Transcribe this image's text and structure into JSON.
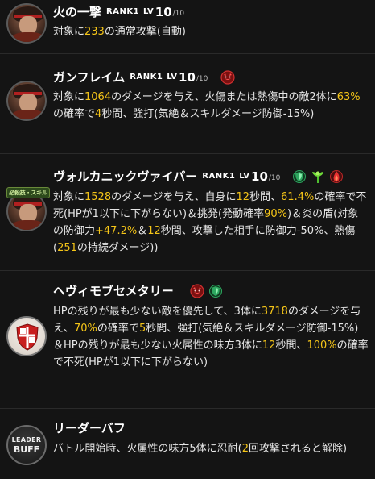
{
  "skills": [
    {
      "title": "火の一撃",
      "rank": "RANK1",
      "lv_prefix": "LV",
      "lv": "10",
      "lv_max": "/10",
      "desc": [
        {
          "t": "対象に"
        },
        {
          "t": "233",
          "h": true
        },
        {
          "t": "の通常攻撃(自動)"
        }
      ]
    },
    {
      "title": "ガンフレイム",
      "rank": "RANK1",
      "lv_prefix": "LV",
      "lv": "10",
      "lv_max": "/10",
      "desc": [
        {
          "t": "対象に"
        },
        {
          "t": "1064",
          "h": true
        },
        {
          "t": "のダメージを与え、火傷または熱傷中の敵2体に"
        },
        {
          "t": "63%",
          "h": true
        },
        {
          "t": "の確率で"
        },
        {
          "t": "4",
          "h": true
        },
        {
          "t": "秒間、強打(気絶＆スキルダメージ防御-15%)"
        }
      ]
    },
    {
      "title": "ヴォルカニックヴァイパー",
      "rank": "RANK1",
      "lv_prefix": "LV",
      "lv": "10",
      "lv_max": "/10",
      "badge": "必殺技・スキル",
      "desc": [
        {
          "t": "対象に"
        },
        {
          "t": "1528",
          "h": true
        },
        {
          "t": "のダメージを与え、自身に"
        },
        {
          "t": "12",
          "h": true
        },
        {
          "t": "秒間、"
        },
        {
          "t": "61.4%",
          "h": true
        },
        {
          "t": "の確率で不死(HPが1以下に下がらない)＆挑発(発動確率"
        },
        {
          "t": "90%",
          "h": true
        },
        {
          "t": ")＆炎の盾(対象の防御力"
        },
        {
          "t": "+47.2%",
          "h": true
        },
        {
          "t": "＆"
        },
        {
          "t": "12",
          "h": true
        },
        {
          "t": "秒間、攻撃した相手に防御力-50%、熱傷("
        },
        {
          "t": "251",
          "h": true
        },
        {
          "t": "の持続ダメージ))"
        }
      ]
    },
    {
      "title": "ヘヴィモブセメタリー",
      "desc": [
        {
          "t": "HPの残りが最も少ない敵を優先して、3体に"
        },
        {
          "t": "3718",
          "h": true
        },
        {
          "t": "のダメージを与え、"
        },
        {
          "t": "70%",
          "h": true
        },
        {
          "t": "の確率で"
        },
        {
          "t": "5",
          "h": true
        },
        {
          "t": "秒間、強打(気絶＆スキルダメージ防御-15%)＆HPの残りが最も少ない火属性の味方3体に"
        },
        {
          "t": "12",
          "h": true
        },
        {
          "t": "秒間、"
        },
        {
          "t": "100%",
          "h": true
        },
        {
          "t": "の確率で不死(HPが1以下に下がらない)"
        }
      ]
    },
    {
      "title": "リーダーバフ",
      "leader_icon": [
        "LEADER",
        "BUFF"
      ],
      "desc": [
        {
          "t": "バトル開始時、火属性の味方5体に忍耐("
        },
        {
          "t": "2",
          "h": true
        },
        {
          "t": "回攻撃されると解除)"
        }
      ]
    }
  ],
  "icons": {
    "skill2": [
      "red-demon-icon"
    ],
    "skill3": [
      "green-shield-icon",
      "green-plant-icon",
      "red-flame-icon"
    ],
    "skill4": [
      "red-demon-icon",
      "green-shield-icon"
    ]
  },
  "colors": {
    "highlight": "#f5c518",
    "background": "#141414",
    "text": "#e6e6e6"
  }
}
